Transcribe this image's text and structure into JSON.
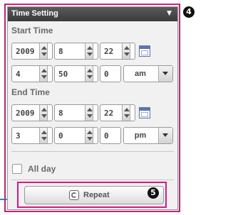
{
  "panel": {
    "title": "Time Setting"
  },
  "start": {
    "label": "Start Time",
    "year": "2009",
    "month": "8",
    "day": "22",
    "hour": "4",
    "minute": "50",
    "second": "0",
    "ampm": "am"
  },
  "end": {
    "label": "End Time",
    "year": "2009",
    "month": "8",
    "day": "22",
    "hour": "3",
    "minute": "0",
    "second": "0",
    "ampm": "pm"
  },
  "allday": {
    "label": "All day",
    "checked": false
  },
  "repeat": {
    "label": "Repeat"
  },
  "callouts": {
    "panel": "4",
    "repeat": "5"
  },
  "colors": {
    "callout_frame": "#d81b7f",
    "leader_line": "#1a8fcf",
    "titlebar": "#4a4a4a"
  },
  "icons": [
    "chevron-down-icon",
    "spin-up-icon",
    "spin-down-icon",
    "calendar-icon",
    "dropdown-arrow-icon",
    "repeat-icon"
  ]
}
